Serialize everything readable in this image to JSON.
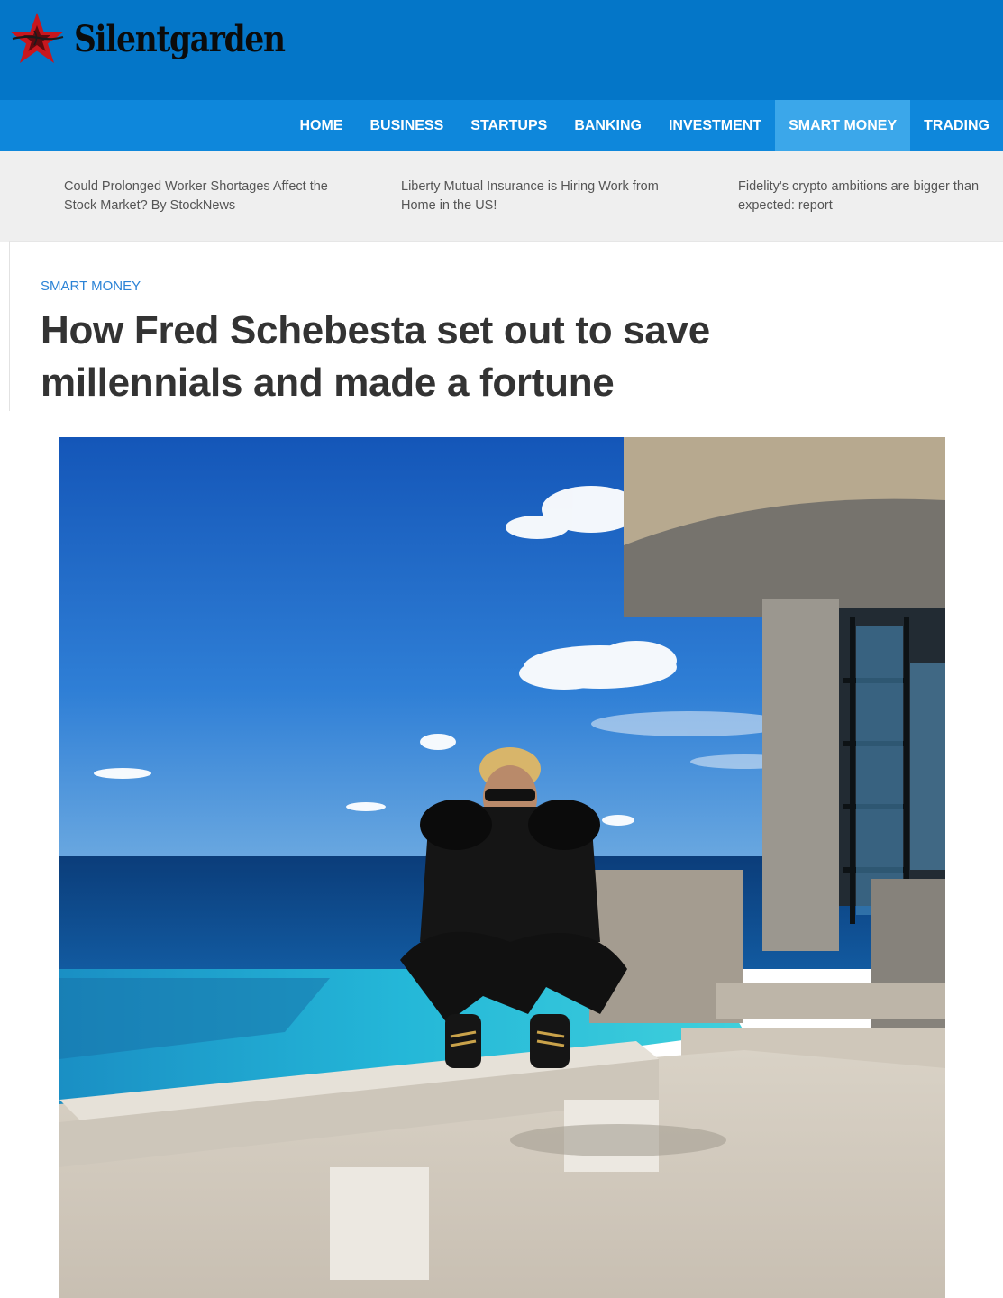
{
  "site": {
    "name": "Silentgarden"
  },
  "nav": {
    "items": [
      "HOME",
      "BUSINESS",
      "STARTUPS",
      "BANKING",
      "INVESTMENT",
      "SMART MONEY",
      "TRADING"
    ],
    "active": "SMART MONEY"
  },
  "ticker": [
    "Could Prolonged Worker Shortages Affect the Stock Market? By StockNews",
    "Liberty Mutual Insurance is Hiring Work from Home in the US!",
    "Fidelity's crypto ambitions are bigger than expected: report"
  ],
  "article": {
    "category": "SMART MONEY",
    "title": "How Fred Schebesta set out to save millennials and made a fortune"
  }
}
